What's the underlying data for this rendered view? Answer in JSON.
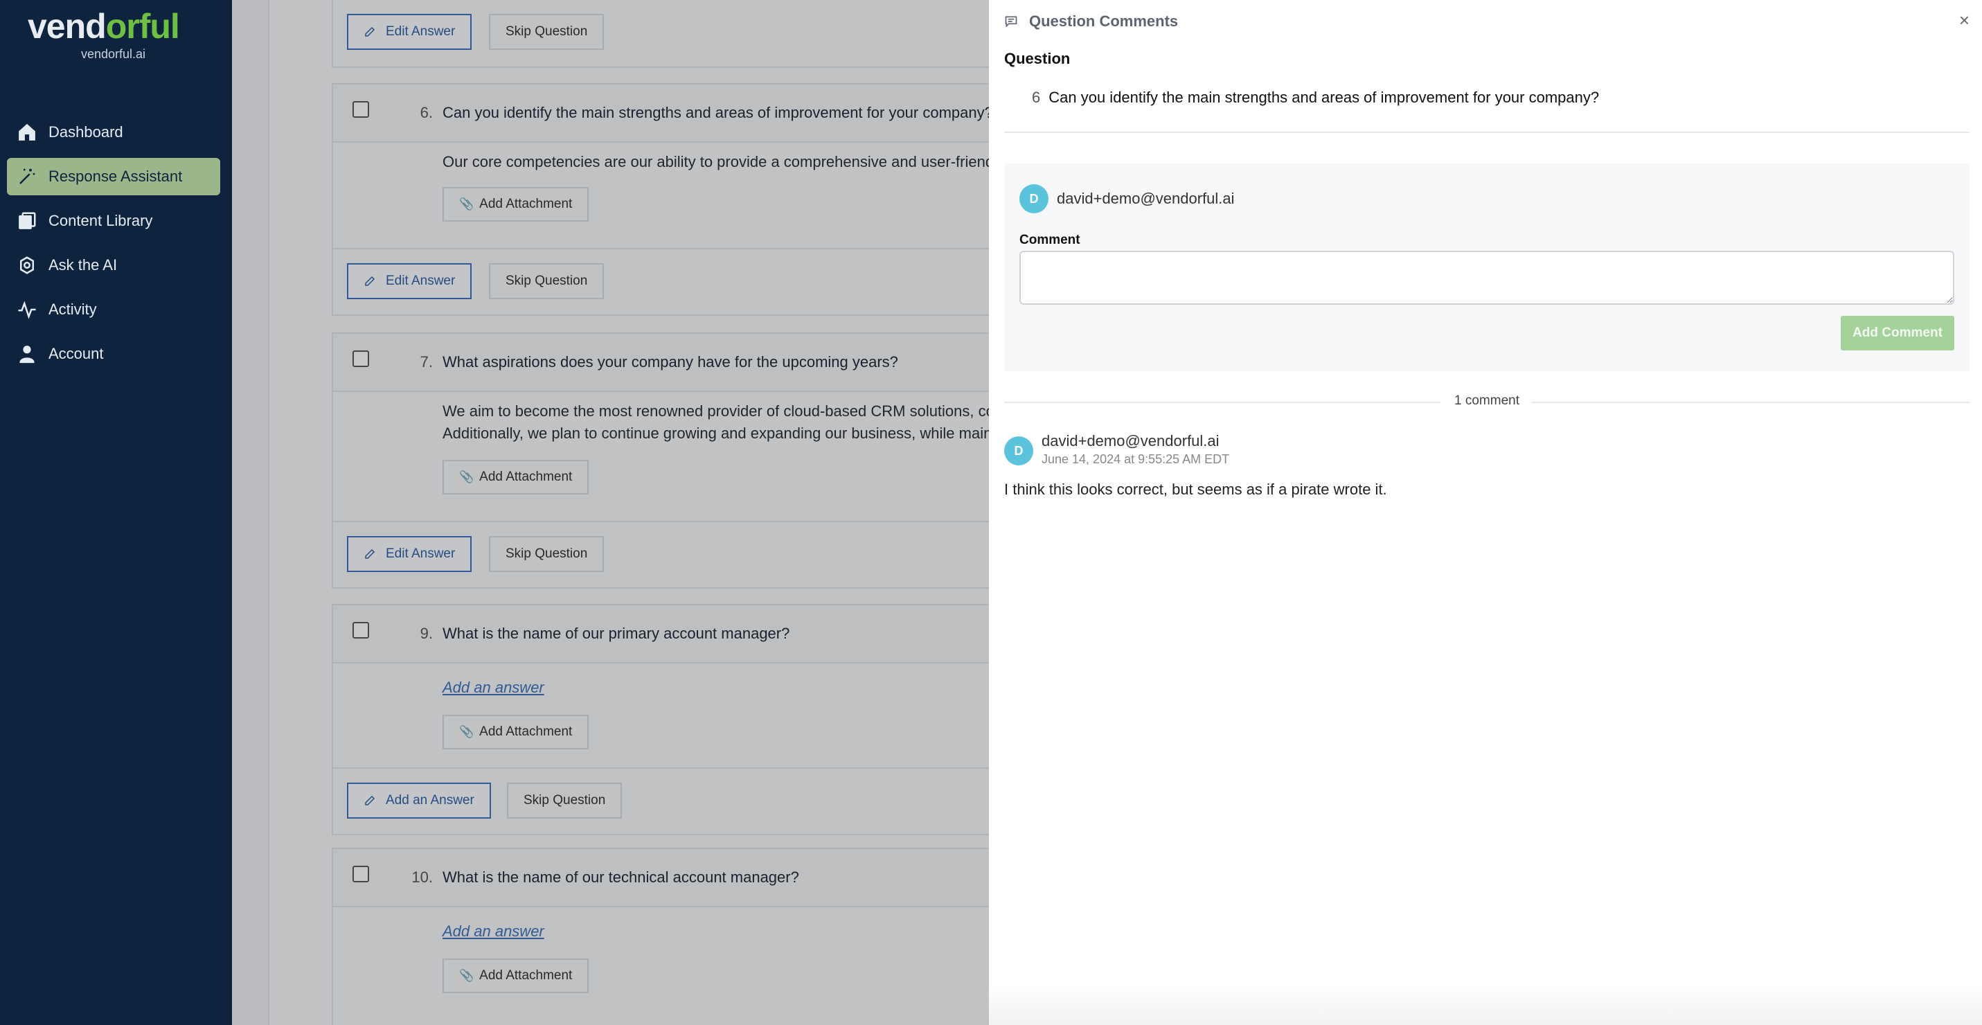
{
  "brand": {
    "wordmark_a": "vend",
    "wordmark_b": "orful",
    "subtitle": "vendorful.ai",
    "wordmark_color": "#6fbf45"
  },
  "sidebar": {
    "items": [
      {
        "label": "Dashboard",
        "icon": "home-icon",
        "active": false
      },
      {
        "label": "Response Assistant",
        "icon": "magic-wand-icon",
        "active": true
      },
      {
        "label": "Content Library",
        "icon": "library-icon",
        "active": false
      },
      {
        "label": "Ask the AI",
        "icon": "ai-icon",
        "active": false
      },
      {
        "label": "Activity",
        "icon": "activity-icon",
        "active": false
      },
      {
        "label": "Account",
        "icon": "user-icon",
        "active": false
      }
    ]
  },
  "main": {
    "buttons": {
      "edit": "Edit Answer",
      "skip": "Skip Question",
      "attach": "Add Attachment",
      "add_answer": "Add an Answer"
    },
    "add_answer_link": "Add an answer",
    "questions": [
      {
        "num": "6.",
        "text": "Can you identify the main strengths and areas of improvement for your company?",
        "answer_lines": [
          "Our core competencies are our ability to provide a comprehensive and user-friendly CRM solu"
        ]
      },
      {
        "num": "7.",
        "text": "What aspirations does your company have for the upcoming years?",
        "answer_lines": [
          "We aim to become the most renowned provider of cloud-based CRM solutions, constantly inn",
          "Additionally, we plan to continue growing and expanding our business, while maintaining our"
        ]
      },
      {
        "num": "9.",
        "text": "What is the name of our primary account manager?",
        "answer_lines": []
      },
      {
        "num": "10.",
        "text": "What is the name of our technical account manager?",
        "answer_lines": []
      }
    ]
  },
  "panel": {
    "title": "Question Comments",
    "question_heading": "Question",
    "question_number": "6",
    "question_text": "Can you identify the main strengths and areas of improvement for your company?",
    "current_user": "david+demo@vendorful.ai",
    "avatar_initial": "D",
    "comment_label": "Comment",
    "comment_placeholder": "",
    "submit_label": "Add Comment",
    "comment_count": "1 comment",
    "comments": [
      {
        "author": "david+demo@vendorful.ai",
        "timestamp": "June 14, 2024 at 9:55:25 AM EDT",
        "text": "I think this looks correct, but seems as if a pirate wrote it.",
        "initial": "D"
      }
    ]
  }
}
